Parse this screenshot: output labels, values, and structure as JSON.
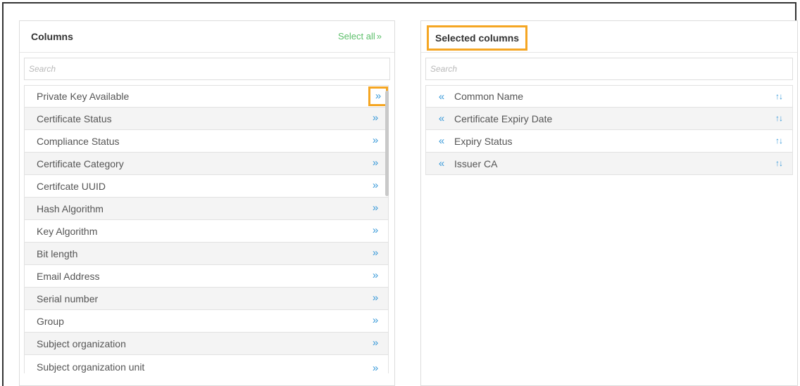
{
  "columns_panel": {
    "title": "Columns",
    "select_all": "Select all",
    "search_placeholder": "Search",
    "items": [
      "Private Key Available",
      "Certificate Status",
      "Compliance Status",
      "Certificate Category",
      "Certifcate UUID",
      "Hash Algorithm",
      "Key Algorithm",
      "Bit length",
      "Email Address",
      "Serial number",
      "Group",
      "Subject organization",
      "Subject organization unit"
    ]
  },
  "selected_panel": {
    "title": "Selected columns",
    "search_placeholder": "Search",
    "items": [
      "Common Name",
      "Certificate Expiry Date",
      "Expiry Status",
      "Issuer CA"
    ]
  },
  "icons": {
    "add": "double-chevron-right",
    "remove": "double-chevron-left",
    "reorder": "sort-arrows"
  },
  "colors": {
    "accent_blue": "#3a9ad9",
    "select_all_green": "#5cbf6a",
    "highlight_orange": "#f5a623"
  }
}
